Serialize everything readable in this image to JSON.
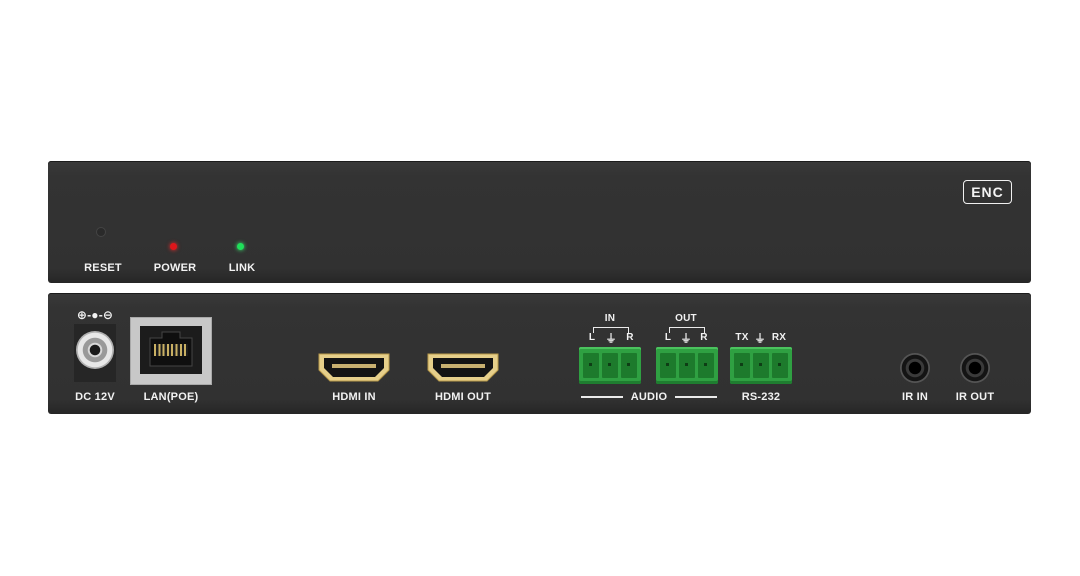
{
  "front_panel": {
    "badge": "ENC",
    "reset_label": "RESET",
    "power_label": "POWER",
    "link_label": "LINK",
    "colors": {
      "power_led": "#e0161b",
      "link_led": "#1fe05a"
    }
  },
  "rear_panel": {
    "dc_symbol": "⊕-●-⊖",
    "dc_label": "DC 12V",
    "lan_label": "LAN(POE)",
    "hdmi_in_label": "HDMI IN",
    "hdmi_out_label": "HDMI OUT",
    "audio_in_label": "IN",
    "audio_out_label": "OUT",
    "left_label": "L",
    "right_label": "R",
    "ground_symbol": "⏚",
    "audio_label": "AUDIO",
    "tx_label": "TX",
    "rx_label": "RX",
    "rs232_label": "RS-232",
    "ir_in_label": "IR IN",
    "ir_out_label": "IR OUT",
    "colors": {
      "terminal_block": "#2fa042",
      "hdmi_gold": "#e6cf8a"
    }
  }
}
